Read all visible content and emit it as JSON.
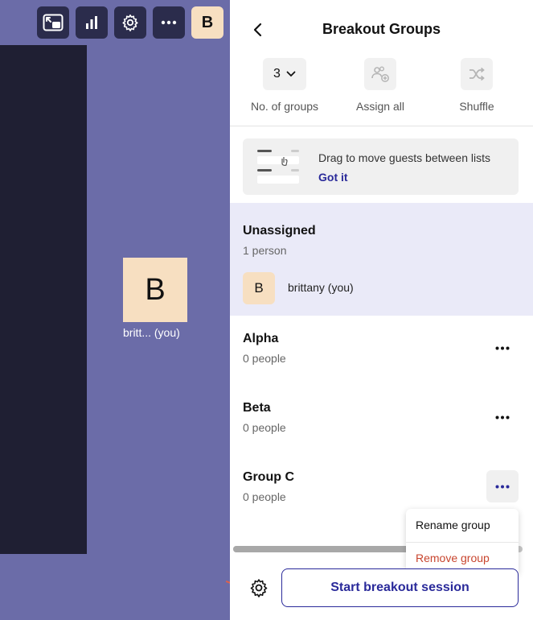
{
  "toolbar": {
    "avatar_letter": "B",
    "icons": [
      "picture-in-picture-icon",
      "stats-icon",
      "settings-icon",
      "more-icon"
    ]
  },
  "stage": {
    "tile_letter": "B",
    "tile_name": "britt...  (you)"
  },
  "panel": {
    "title": "Breakout Groups",
    "controls": {
      "groups_value": "3",
      "groups_label": "No. of groups",
      "assign_label": "Assign all",
      "shuffle_label": "Shuffle"
    },
    "tip": {
      "text": "Drag to move guests between lists",
      "link": "Got it"
    },
    "unassigned": {
      "title": "Unassigned",
      "count": "1 person",
      "person_letter": "B",
      "person_name": "brittany (you)"
    },
    "groups": [
      {
        "name": "Alpha",
        "count": "0 people"
      },
      {
        "name": "Beta",
        "count": "0 people"
      },
      {
        "name": "Group C",
        "count": "0 people"
      }
    ],
    "menu": {
      "rename": "Rename group",
      "remove": "Remove group"
    },
    "footer": {
      "start_label": "Start breakout session"
    }
  },
  "colors": {
    "accent": "#2a2a9a",
    "danger": "#c8452e",
    "stage_bg": "#6b6ca8",
    "avatar_bg": "#f7dfc1"
  }
}
